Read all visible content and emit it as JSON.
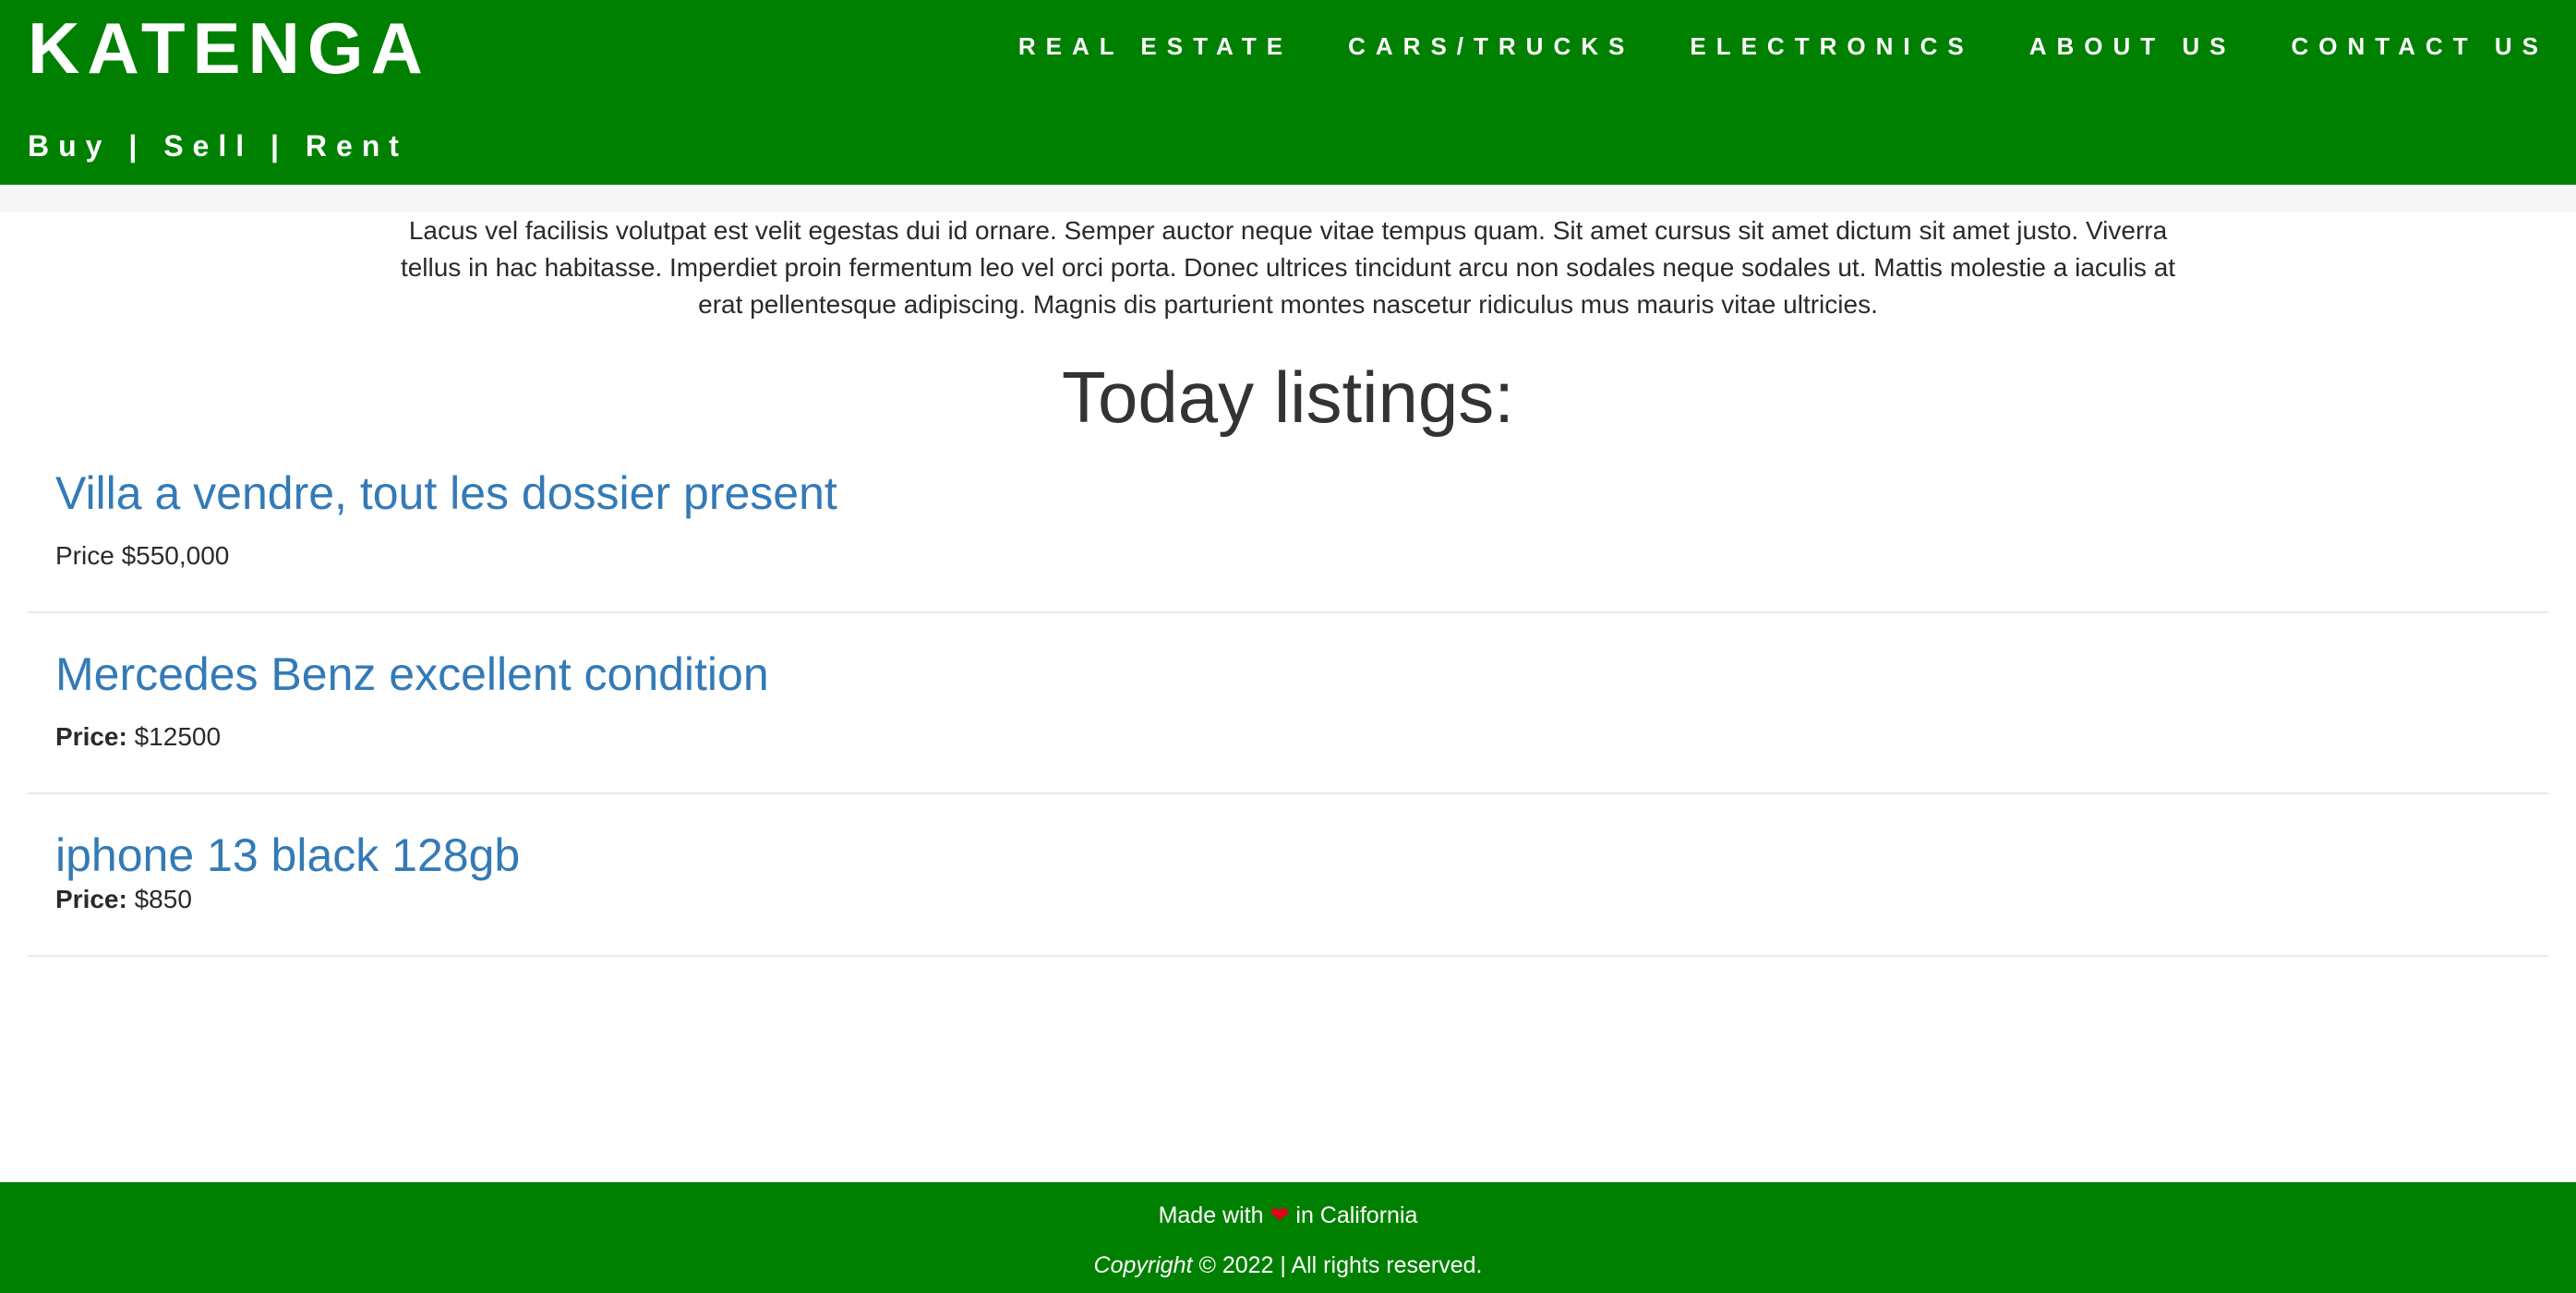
{
  "header": {
    "brand": "KATENGA",
    "tagline": "Buy | Sell | Rent",
    "nav": [
      {
        "label": "REAL ESTATE"
      },
      {
        "label": "CARS/TRUCKS"
      },
      {
        "label": "ELECTRONICS"
      },
      {
        "label": "ABOUT US"
      },
      {
        "label": "CONTACT US"
      }
    ]
  },
  "intro": {
    "text": "Lacus vel facilisis volutpat est velit egestas dui id ornare. Semper auctor neque vitae tempus quam. Sit amet cursus sit amet dictum sit amet justo. Viverra tellus in hac habitasse. Imperdiet proin fermentum leo vel orci porta. Donec ultrices tincidunt arcu non sodales neque sodales ut. Mattis molestie a iaculis at erat pellentesque adipiscing. Magnis dis parturient montes nascetur ridiculus mus mauris vitae ultricies."
  },
  "listings_heading": "Today listings:",
  "listings": [
    {
      "title": "Villa a vendre, tout les dossier present",
      "price_label": "Price",
      "price_value": "$550,000"
    },
    {
      "title": "Mercedes Benz excellent condition",
      "price_label": "Price:",
      "price_value": "$12500"
    },
    {
      "title": "iphone 13 black 128gb",
      "price_label": "Price:",
      "price_value": "$850"
    }
  ],
  "footer": {
    "made_prefix": "Made with",
    "heart": "❤",
    "made_suffix": "in California",
    "copyright_word": "Copyright",
    "copyright_rest": "© 2022 | All rights reserved."
  },
  "colors": {
    "header_bg": "#008000",
    "link": "#337ab7",
    "heart": "#e0001b"
  }
}
